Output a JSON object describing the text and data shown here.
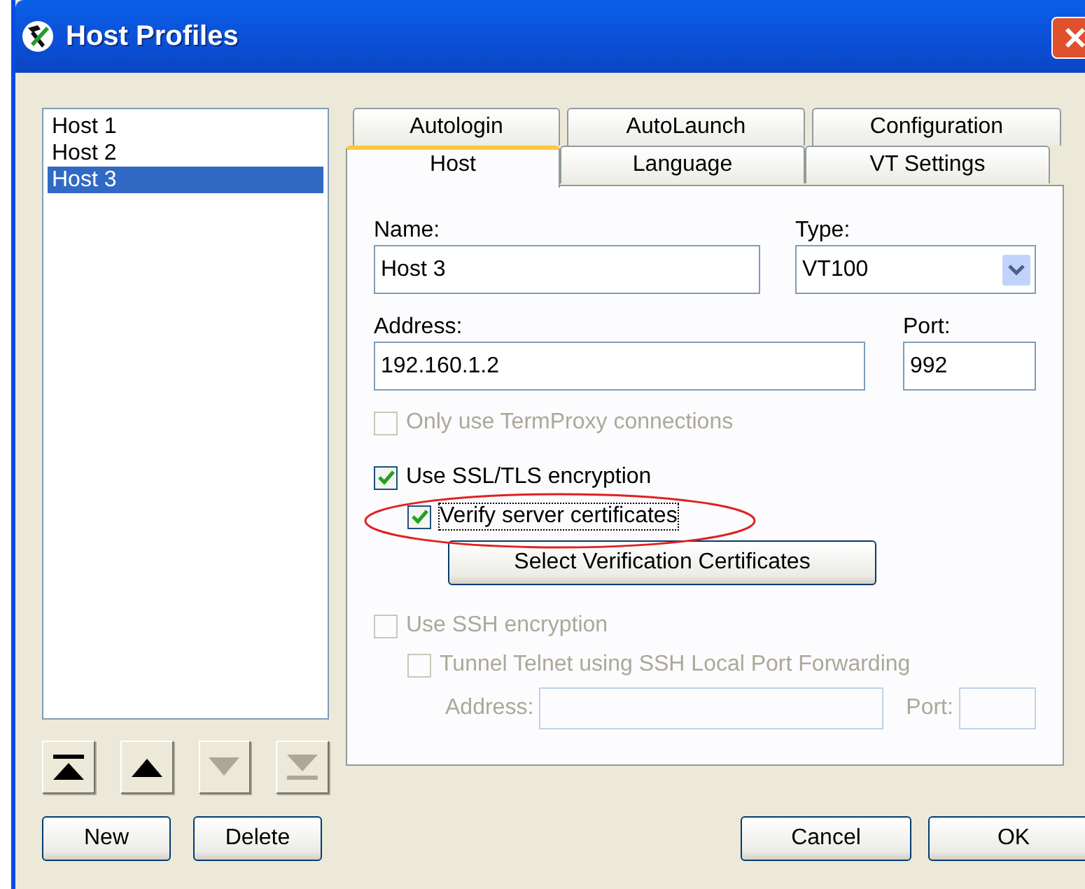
{
  "window": {
    "title": "Host Profiles"
  },
  "hosts": [
    {
      "label": "Host 1",
      "selected": false
    },
    {
      "label": "Host 2",
      "selected": false
    },
    {
      "label": "Host 3",
      "selected": true
    }
  ],
  "move_buttons": [
    {
      "kind": "top",
      "disabled": false
    },
    {
      "kind": "up",
      "disabled": false
    },
    {
      "kind": "down",
      "disabled": true
    },
    {
      "kind": "bottom",
      "disabled": true
    }
  ],
  "tab_rows": [
    [
      {
        "label": "Autologin",
        "selected": false
      },
      {
        "label": "AutoLaunch",
        "selected": false
      },
      {
        "label": "Configuration",
        "selected": false
      }
    ],
    [
      {
        "label": "Host",
        "selected": true
      },
      {
        "label": "Language",
        "selected": false
      },
      {
        "label": "VT Settings",
        "selected": false
      }
    ]
  ],
  "host_tab": {
    "name": {
      "label": "Name:",
      "value": "Host 3"
    },
    "type": {
      "label": "Type:",
      "value": "VT100"
    },
    "address": {
      "label": "Address:",
      "value": "192.160.1.2"
    },
    "port": {
      "label": "Port:",
      "value": "992"
    },
    "termproxy": {
      "label": "Only use TermProxy connections",
      "checked": false,
      "disabled": true
    },
    "ssl": {
      "label": "Use SSL/TLS encryption",
      "checked": true,
      "disabled": false
    },
    "verify": {
      "label": "Verify server certificates",
      "checked": true,
      "disabled": false,
      "focused": true,
      "circled": true
    },
    "select_certificates_button": "Select Verification Certificates",
    "ssh": {
      "label": "Use SSH encryption",
      "checked": false,
      "disabled": true
    },
    "tunnel": {
      "label": "Tunnel Telnet using SSH Local Port Forwarding",
      "checked": false,
      "disabled": true
    },
    "tunnel_address": {
      "label": "Address:",
      "disabled": true
    },
    "tunnel_port": {
      "label": "Port:",
      "disabled": true
    }
  },
  "buttons": {
    "left": [
      "New",
      "Delete"
    ],
    "right": [
      "Cancel",
      "OK"
    ]
  }
}
